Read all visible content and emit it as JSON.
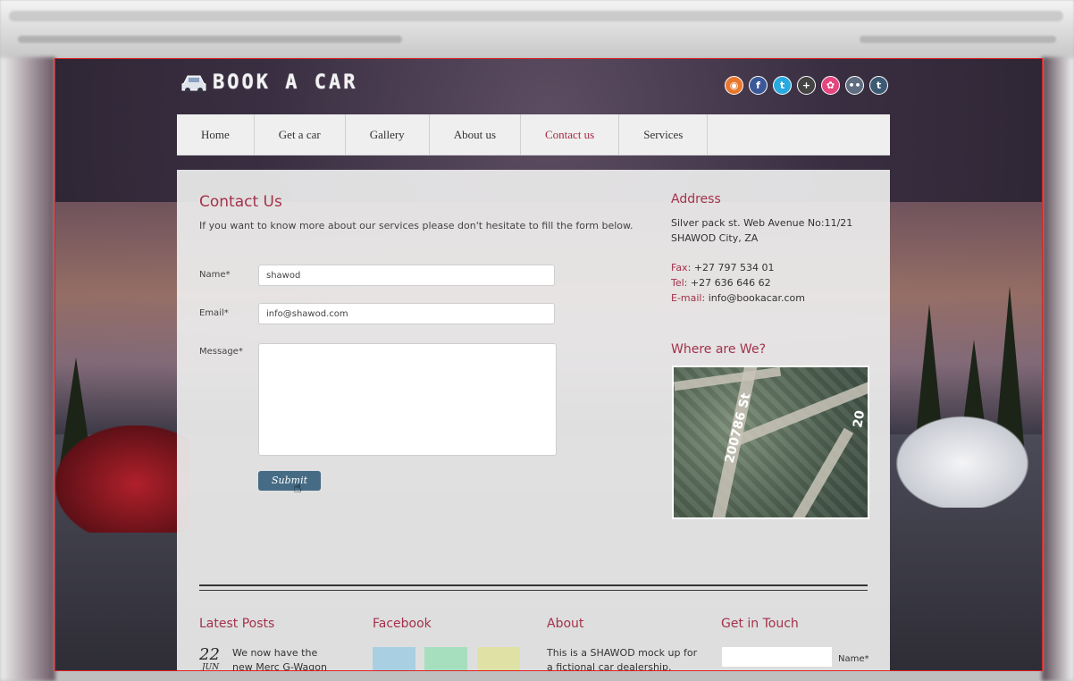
{
  "site": {
    "logo_text": "BOOK A CAR"
  },
  "social": [
    "rss-icon",
    "facebook-icon",
    "twitter-icon",
    "plus-icon",
    "dribbble-icon",
    "flickr-icon",
    "tumblr-icon"
  ],
  "nav": {
    "items": [
      "Home",
      "Get a car",
      "Gallery",
      "About us",
      "Contact us",
      "Services"
    ],
    "active": "Contact us"
  },
  "contact": {
    "title": "Contact Us",
    "intro": "If you want to know more about our services please don't hesitate to fill the form below.",
    "name_label": "Name*",
    "name_value": "shawod",
    "email_label": "Email*",
    "email_value": "info@shawod.com",
    "message_label": "Message*",
    "message_value": "",
    "submit_label": "Submit"
  },
  "address": {
    "heading": "Address",
    "line1": "Silver pack st. Web Avenue No:11/21",
    "line2": "SHAWOD City, ZA",
    "fax_label": "Fax:",
    "fax": "+27 797 534 01",
    "tel_label": "Tel:",
    "tel": "+27 636 646 62",
    "email_label": "E-mail:",
    "email": "info@bookacar.com"
  },
  "map": {
    "heading": "Where are We?",
    "street_label": "200786 St",
    "street_label2": "20"
  },
  "footer": {
    "latest_posts": "Latest Posts",
    "post_day": "22",
    "post_month": "JUN",
    "post_text": "We now have the new Merc G-Wagon",
    "facebook": "Facebook",
    "about": "About",
    "about_text": "This is a SHAWOD mock up for a fictional car dealership. Integer",
    "get_in_touch": "Get in Touch",
    "touch_name_label": "Name*"
  },
  "colors": {
    "accent": "#a3324a",
    "button": "#456b85"
  }
}
